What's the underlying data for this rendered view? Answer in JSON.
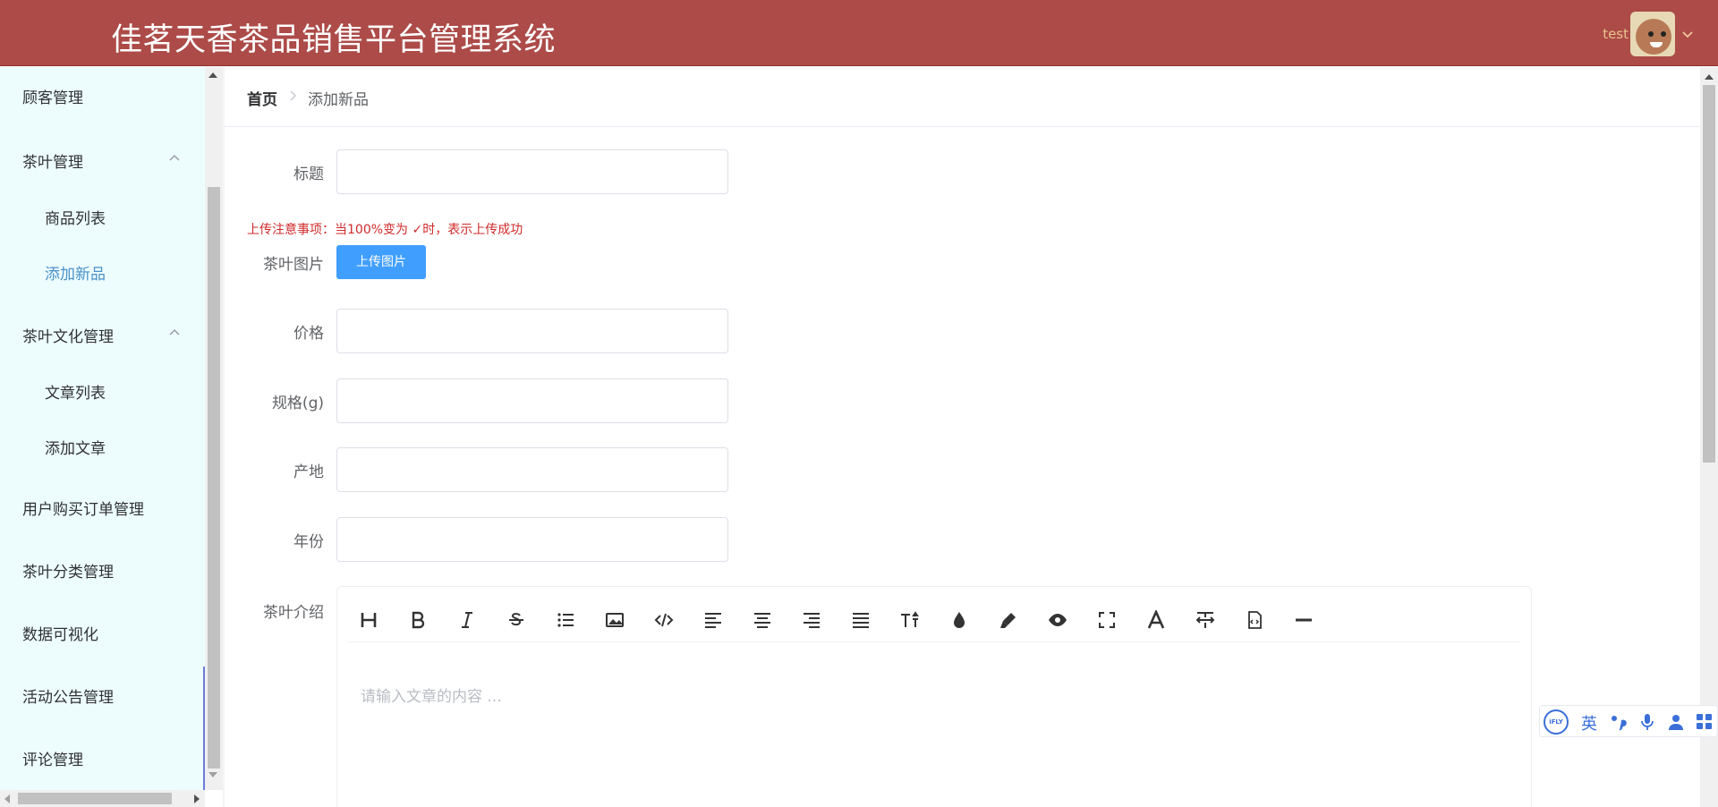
{
  "header": {
    "title": "佳茗天香茶品销售平台管理系统",
    "username": "test",
    "bg_color": "#ac4b48"
  },
  "sidebar": {
    "items": [
      {
        "label": "顾客管理"
      },
      {
        "label": "茶叶管理"
      },
      {
        "label": "商品列表"
      },
      {
        "label": "添加新品"
      },
      {
        "label": "茶叶文化管理"
      },
      {
        "label": "文章列表"
      },
      {
        "label": "添加文章"
      },
      {
        "label": "用户购买订单管理"
      },
      {
        "label": "茶叶分类管理"
      },
      {
        "label": "数据可视化"
      },
      {
        "label": "活动公告管理"
      },
      {
        "label": "评论管理"
      }
    ],
    "active_color": "#4a90c9",
    "bg_color": "#edfdfe"
  },
  "breadcrumb": {
    "home": "首页",
    "current": "添加新品"
  },
  "form": {
    "title_label": "标题",
    "notice": "上传注意事项：当100%变为 ✓时，表示上传成功",
    "image_label": "茶叶图片",
    "upload_button": "上传图片",
    "price_label": "价格",
    "spec_label": "规格(g)",
    "origin_label": "产地",
    "year_label": "年份",
    "intro_label": "茶叶介绍",
    "title_value": "",
    "price_value": "",
    "spec_value": "",
    "origin_value": "",
    "year_value": ""
  },
  "editor": {
    "placeholder": "请输入文章的内容 ...",
    "tools": [
      "heading-icon",
      "bold-icon",
      "italic-icon",
      "strikethrough-icon",
      "list-icon",
      "image-icon",
      "code-icon",
      "align-left-icon",
      "align-center-icon",
      "align-right-icon",
      "align-justify-icon",
      "text-size-icon",
      "color-drop-icon",
      "highlighter-icon",
      "preview-eye-icon",
      "fullscreen-icon",
      "font-icon",
      "text-format-icon",
      "file-icon",
      "horizontal-rule-icon"
    ]
  },
  "ime": {
    "logo": "iFLY",
    "lang": "英"
  }
}
